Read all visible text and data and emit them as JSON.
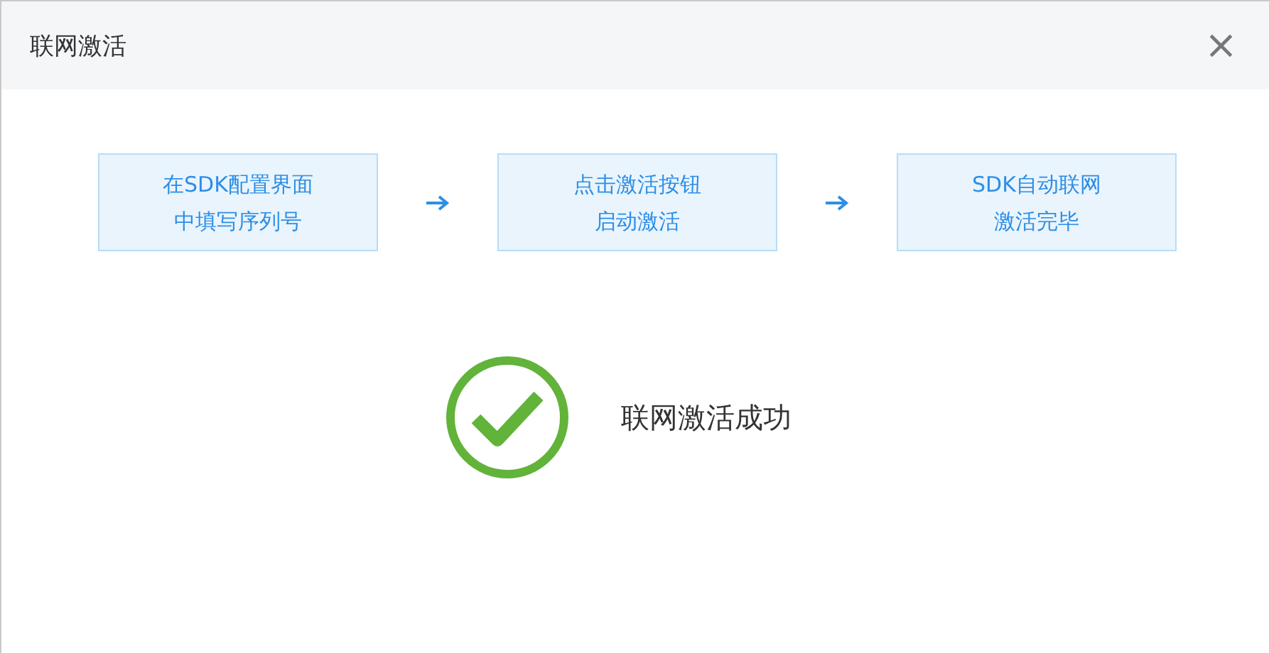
{
  "window": {
    "title": "联网激活",
    "close": "×"
  },
  "steps": [
    {
      "lines": [
        "在SDK配置界面",
        "中填写序列号"
      ]
    },
    {
      "lines": [
        "点击激活按钮",
        "启动激活"
      ]
    },
    {
      "lines": [
        "SDK自动联网",
        "激活完毕"
      ]
    }
  ],
  "result": {
    "message": "联网激活成功"
  }
}
